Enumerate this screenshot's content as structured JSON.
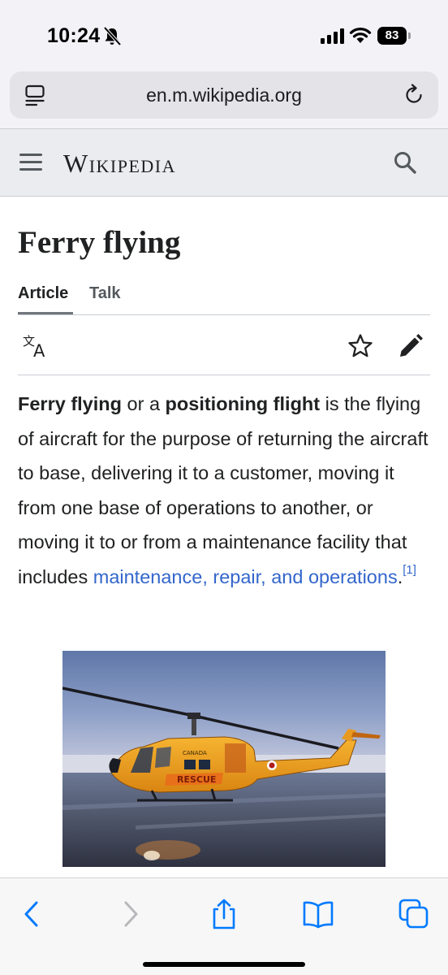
{
  "status": {
    "time": "10:24",
    "battery": "83"
  },
  "browser": {
    "url": "en.m.wikipedia.org"
  },
  "wiki": {
    "wordmark": "Wikipedia"
  },
  "page": {
    "title": "Ferry flying",
    "tabs": [
      {
        "label": "Article"
      },
      {
        "label": "Talk"
      }
    ],
    "paragraph": {
      "bold1": "Ferry flying",
      "text1": " or a ",
      "bold2": "positioning flight",
      "text2": " is the flying of aircraft for the purpose of returning the aircraft to base, delivering it to a customer, moving it from one base of operations to another, or moving it to or from a maintenance facility that includes ",
      "link": "maintenance, repair, and operations",
      "text3": ".",
      "ref": "[1]"
    },
    "image": {
      "fuselage_text": "CANADA",
      "side_text": "RESCUE"
    }
  },
  "icons": {
    "reader": "reader-mode-icon",
    "reload": "reload-icon",
    "menu": "hamburger-menu-icon",
    "search": "search-icon",
    "language": "language-translate-icon",
    "watch": "star-icon",
    "edit": "pencil-edit-icon",
    "back": "chevron-left-icon",
    "forward": "chevron-right-icon",
    "share": "share-icon",
    "bookmarks": "book-icon",
    "tabs": "tabs-icon"
  },
  "colors": {
    "link": "#3366cc",
    "toolbar_accent": "#007aff",
    "header_bg": "#eaecf0",
    "helicopter_orange": "#f0a020"
  }
}
